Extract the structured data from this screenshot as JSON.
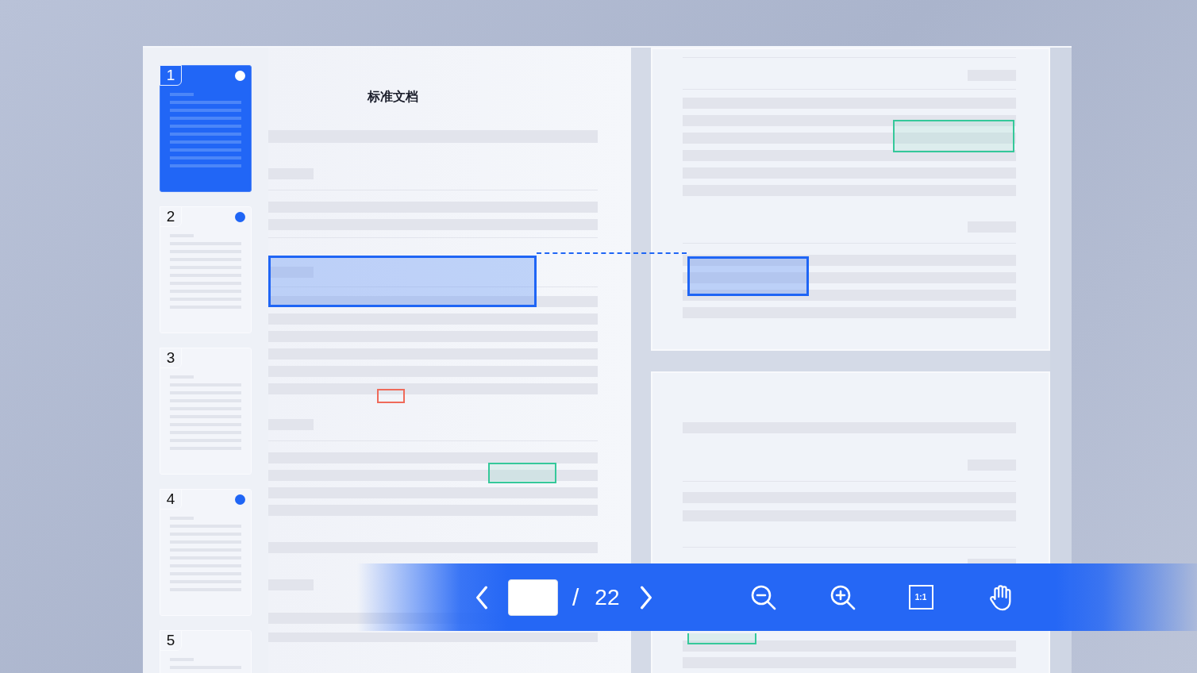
{
  "thumbnails": [
    {
      "number": "1",
      "selected": true,
      "marked": true
    },
    {
      "number": "2",
      "selected": false,
      "marked": true
    },
    {
      "number": "3",
      "selected": false,
      "marked": false
    },
    {
      "number": "4",
      "selected": false,
      "marked": true
    },
    {
      "number": "5",
      "selected": false,
      "marked": false
    }
  ],
  "document": {
    "title": "标准文档"
  },
  "toolbar": {
    "separator": "/",
    "total_pages": "22",
    "fit_label": "1:1"
  }
}
